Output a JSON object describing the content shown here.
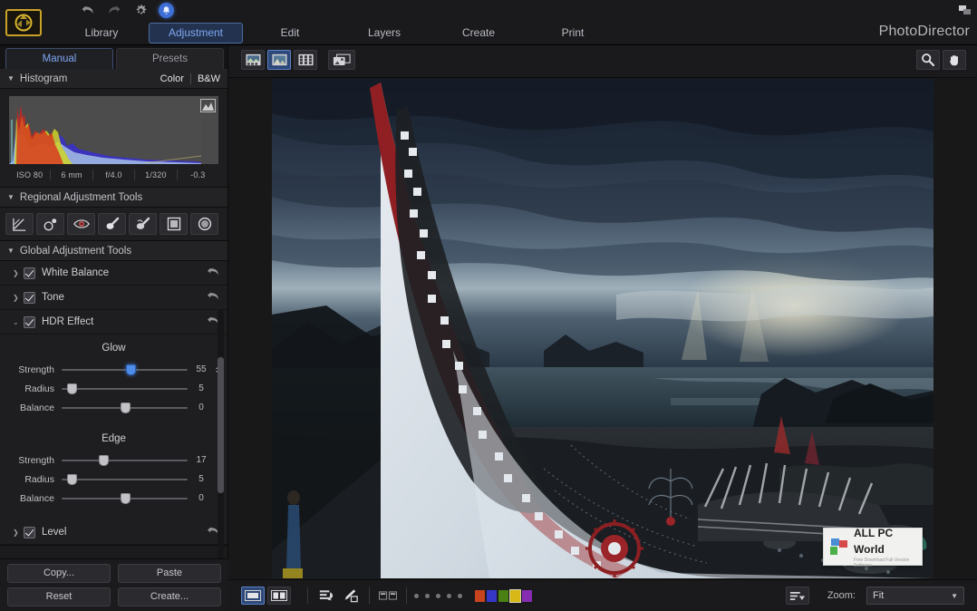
{
  "app": {
    "brand": "PhotoDirector",
    "logo_icon": "aperture-logo-icon",
    "restore_icon": "window-restore-icon"
  },
  "topbar": {
    "icons": [
      {
        "name": "undo-icon",
        "label": "Undo"
      },
      {
        "name": "redo-icon",
        "label": "Redo"
      },
      {
        "name": "gear-icon",
        "label": "Settings"
      },
      {
        "name": "notification-icon",
        "label": "Notifications"
      }
    ],
    "tabs": [
      {
        "label": "Library",
        "active": false
      },
      {
        "label": "Adjustment",
        "active": true
      },
      {
        "label": "Edit",
        "active": false
      },
      {
        "label": "Layers",
        "active": false
      },
      {
        "label": "Create",
        "active": false
      },
      {
        "label": "Print",
        "active": false
      }
    ]
  },
  "left_panel": {
    "mode_tabs": [
      {
        "label": "Manual",
        "active": true
      },
      {
        "label": "Presets",
        "active": false
      }
    ],
    "histogram": {
      "title": "Histogram",
      "color_label": "Color",
      "bw_label": "B&W",
      "clip_icon": "clipping-warning-icon",
      "metadata": [
        "ISO 80",
        "6 mm",
        "f/4.0",
        "1/320",
        "-0.3"
      ]
    },
    "regional": {
      "title": "Regional Adjustment Tools",
      "tools": [
        {
          "name": "gradient-mask-tool",
          "label": "Gradient Mask"
        },
        {
          "name": "spot-removal-tool",
          "label": "Spot Removal"
        },
        {
          "name": "red-eye-tool",
          "label": "Red-Eye Removal"
        },
        {
          "name": "adjustment-brush-tool",
          "label": "Adjustment Brush"
        },
        {
          "name": "clone-brush-tool",
          "label": "Clone & Stamp"
        },
        {
          "name": "rectangle-mask-tool",
          "label": "Rectangle Mask"
        },
        {
          "name": "ellipse-mask-tool",
          "label": "Ellipse Mask"
        }
      ]
    },
    "global": {
      "title": "Global Adjustment Tools",
      "items": [
        {
          "label": "White Balance",
          "checked": true,
          "expanded": false
        },
        {
          "label": "Tone",
          "checked": true,
          "expanded": false
        },
        {
          "label": "HDR Effect",
          "checked": true,
          "expanded": true
        },
        {
          "label": "Level",
          "checked": true,
          "expanded": false
        }
      ]
    },
    "hdr": {
      "glow": {
        "title": "Glow",
        "sliders": [
          {
            "label": "Strength",
            "value": "55",
            "pos": 55,
            "active": true,
            "spinner": true
          },
          {
            "label": "Radius",
            "value": "5",
            "pos": 8,
            "active": false,
            "spinner": false
          },
          {
            "label": "Balance",
            "value": "0",
            "pos": 50,
            "active": false,
            "spinner": false
          }
        ]
      },
      "edge": {
        "title": "Edge",
        "sliders": [
          {
            "label": "Strength",
            "value": "17",
            "pos": 33,
            "active": false,
            "spinner": false
          },
          {
            "label": "Radius",
            "value": "5",
            "pos": 8,
            "active": false,
            "spinner": false
          },
          {
            "label": "Balance",
            "value": "0",
            "pos": 50,
            "active": false,
            "spinner": false
          }
        ]
      }
    },
    "buttons": {
      "copy": "Copy...",
      "paste": "Paste",
      "reset": "Reset",
      "create": "Create..."
    }
  },
  "viewer": {
    "view_modes": [
      {
        "name": "filmstrip-view-button",
        "label": "Filmstrip View",
        "active": false
      },
      {
        "name": "single-photo-view-button",
        "label": "Photo View",
        "active": true
      },
      {
        "name": "grid-view-button",
        "label": "Grid View",
        "active": false
      },
      {
        "name": "slideshow-view-button",
        "label": "Slideshow View",
        "active": false
      }
    ],
    "right_tools": [
      {
        "name": "zoom-magnifier-tool",
        "label": "Zoom"
      },
      {
        "name": "hand-pan-tool",
        "label": "Pan"
      }
    ],
    "watermark": {
      "title": "ALL PC World",
      "subtitle": "Free Download Full Version Software"
    }
  },
  "statusbar": {
    "compare_modes": [
      {
        "name": "single-view-button",
        "label": "Single View",
        "active": true
      },
      {
        "name": "compare-view-button",
        "label": "Compare View",
        "active": false
      }
    ],
    "tools": [
      {
        "name": "sort-order-icon",
        "label": "Sort"
      },
      {
        "name": "edit-tag-icon",
        "label": "Tag"
      },
      {
        "name": "align-compare-icon",
        "label": "Align"
      }
    ],
    "rating_dots": 5,
    "color_flags": [
      {
        "name": "flag-red",
        "color": "#d6461d",
        "selected": false
      },
      {
        "name": "flag-blue",
        "color": "#3a3ad6",
        "selected": false
      },
      {
        "name": "flag-green",
        "color": "#4f8a14",
        "selected": false
      },
      {
        "name": "flag-yellow",
        "color": "#e8c617",
        "selected": true
      },
      {
        "name": "flag-purple",
        "color": "#8f2fbf",
        "selected": false
      }
    ],
    "menu_icon": "list-options-icon",
    "zoom_label": "Zoom:",
    "zoom_value": "Fit"
  },
  "theme": {
    "accent": "#4d8ce8",
    "panel_bg": "#1e1e21",
    "app_bg": "#1a1a1c",
    "text": "#c8c8cc"
  }
}
